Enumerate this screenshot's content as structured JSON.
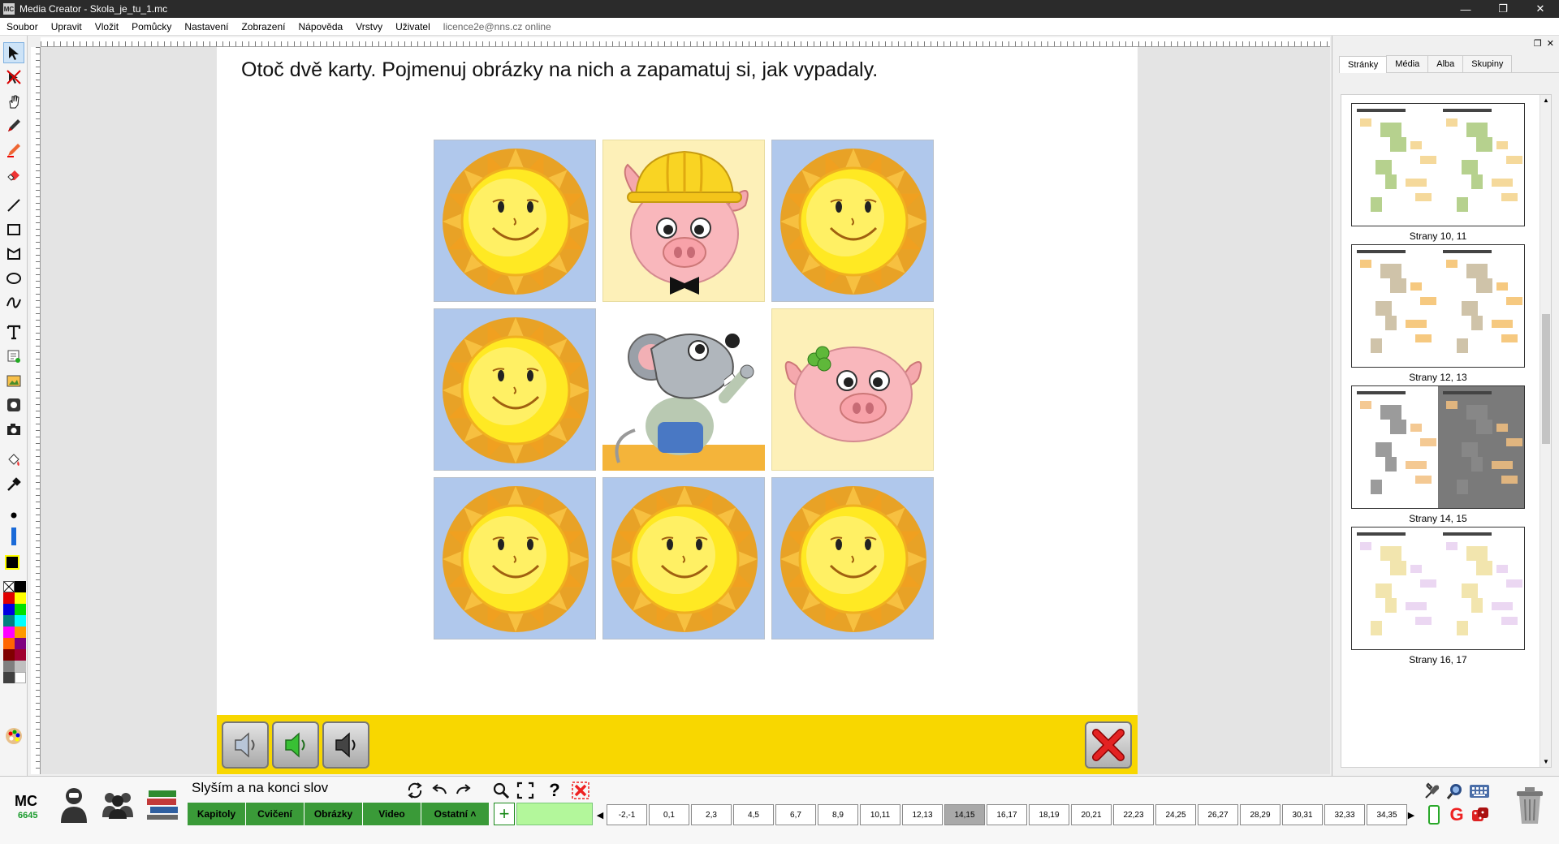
{
  "window": {
    "title": "Media Creator - Skola_je_tu_1.mc",
    "app_icon": "MC",
    "controls": [
      "—",
      "❐",
      "✕"
    ]
  },
  "menu": {
    "items": [
      "Soubor",
      "Upravit",
      "Vložit",
      "Pomůcky",
      "Nastavení",
      "Zobrazení",
      "Nápověda",
      "Vrstvy",
      "Uživatel"
    ],
    "account": "licence2e@nns.cz online"
  },
  "page": {
    "instruction": "Otoč dvě karty. Pojmenuj obrázky na nich a zapamatuj si, jak vypadaly."
  },
  "cards": [
    {
      "type": "sun"
    },
    {
      "type": "pig-helmet"
    },
    {
      "type": "sun"
    },
    {
      "type": "sun"
    },
    {
      "type": "mouse"
    },
    {
      "type": "pig-clover"
    },
    {
      "type": "sun"
    },
    {
      "type": "sun"
    },
    {
      "type": "sun"
    }
  ],
  "right_panel": {
    "tabs": [
      "Stránky",
      "Média",
      "Alba",
      "Skupiny"
    ],
    "active_tab": "Stránky",
    "thumbnails": [
      "Strany 10, 11",
      "Strany 12, 13",
      "Strany 14, 15",
      "Strany 16, 17"
    ]
  },
  "footer": {
    "logo": "MC",
    "version": "6645",
    "chapter_title": "Slyším a na konci slov",
    "buttons": [
      "Kapitoly",
      "Cvičení",
      "Obrázky",
      "Video",
      "Ostatní ˄"
    ],
    "pages": [
      "-2,-1",
      "0,1",
      "2,3",
      "4,5",
      "6,7",
      "8,9",
      "10,11",
      "12,13",
      "14,15",
      "16,17",
      "18,19",
      "20,21",
      "22,23",
      "24,25",
      "26,27",
      "28,29",
      "30,31",
      "32,33",
      "34,35"
    ],
    "active_page": "14,15"
  },
  "colors": {
    "accent_yellow": "#f8d700",
    "green": "#3a9a38",
    "sun_card_bg": "#b0c8ec",
    "face_card_bg": "#fdf0b8"
  }
}
